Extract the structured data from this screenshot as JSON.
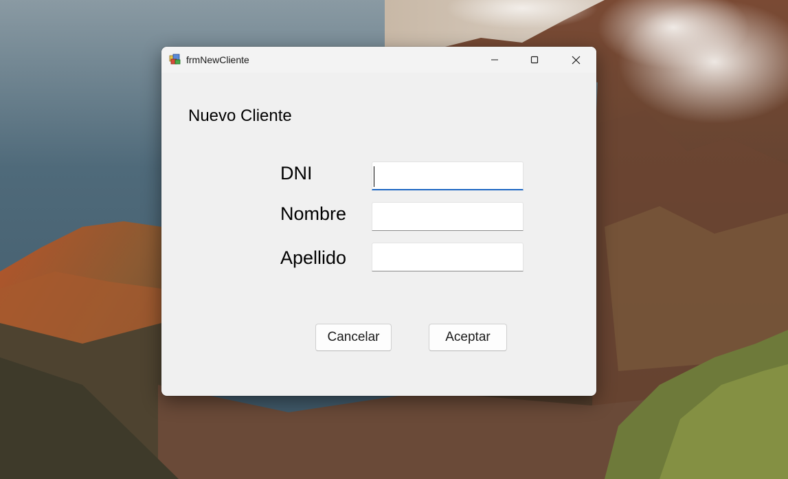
{
  "window": {
    "title": "frmNewCliente",
    "icon": "winforms-app-icon"
  },
  "form": {
    "heading": "Nuevo Cliente",
    "fields": [
      {
        "label": "DNI",
        "value": "",
        "focused": true
      },
      {
        "label": "Nombre",
        "value": ""
      },
      {
        "label": "Apellido",
        "value": ""
      }
    ],
    "buttons": {
      "cancel_label": "Cancelar",
      "accept_label": "Aceptar"
    }
  },
  "colors": {
    "window_bg": "#f0f0f0",
    "focus_accent": "#1a65c2"
  }
}
